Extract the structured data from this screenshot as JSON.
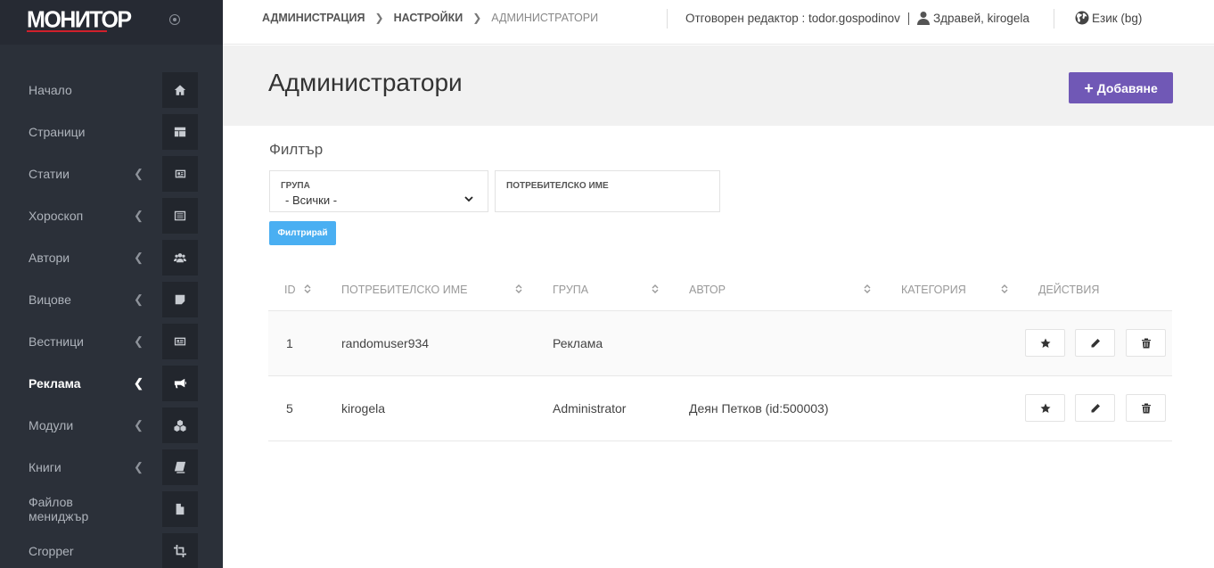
{
  "sidebar": {
    "logo": "МОНИТОР",
    "items": [
      {
        "label": "Начало",
        "icon": "home-icon",
        "chevron": false
      },
      {
        "label": "Страници",
        "icon": "layout-icon",
        "chevron": false
      },
      {
        "label": "Статии",
        "icon": "newspaper-icon",
        "chevron": true
      },
      {
        "label": "Хороскоп",
        "icon": "list-alt-icon",
        "chevron": true
      },
      {
        "label": "Автори",
        "icon": "users-icon",
        "chevron": true
      },
      {
        "label": "Вицове",
        "icon": "sticky-note-icon",
        "chevron": true
      },
      {
        "label": "Вестници",
        "icon": "newspaper-alt-icon",
        "chevron": true
      },
      {
        "label": "Реклама",
        "icon": "bullhorn-icon",
        "chevron": true,
        "active": true
      },
      {
        "label": "Модули",
        "icon": "cubes-icon",
        "chevron": true
      },
      {
        "label": "Книги",
        "icon": "book-icon",
        "chevron": true
      },
      {
        "label": "Файлов мениджър",
        "icon": "file-icon",
        "chevron": false
      },
      {
        "label": "Cropper",
        "icon": "crop-icon",
        "chevron": false
      }
    ]
  },
  "topbar": {
    "breadcrumbs": [
      "АДМИНИСТРАЦИЯ",
      "НАСТРОЙКИ",
      "АДМИНИСТРАТОРИ"
    ],
    "editor": "Отговорен редактор : todor.gospodinov",
    "greeting": "Здравей, kirogela",
    "language": "Език (bg)"
  },
  "header": {
    "title": "Администратори",
    "add_label": "Добавяне"
  },
  "filter": {
    "title": "Филтър",
    "group_label": "ГРУПА",
    "group_value": "- Всички -",
    "username_label": "ПОТРЕБИТЕЛСКО ИМЕ",
    "username_value": "",
    "submit_label": "Филтрирай"
  },
  "table": {
    "columns": [
      "ID",
      "ПОТРЕБИТЕЛСКО ИМЕ",
      "ГРУПА",
      "АВТОР",
      "КАТЕГОРИЯ",
      "ДЕЙСТВИЯ"
    ],
    "rows": [
      {
        "id": "1",
        "username": "randomuser934",
        "group": "Реклама",
        "author": "",
        "category": ""
      },
      {
        "id": "5",
        "username": "kirogela",
        "group": "Administrator",
        "author": "Деян Петков (id:500003)",
        "category": ""
      }
    ]
  },
  "colors": {
    "sidebar_bg": "#2b3039",
    "accent_purple": "#7058b6",
    "accent_blue": "#4aaff2"
  }
}
